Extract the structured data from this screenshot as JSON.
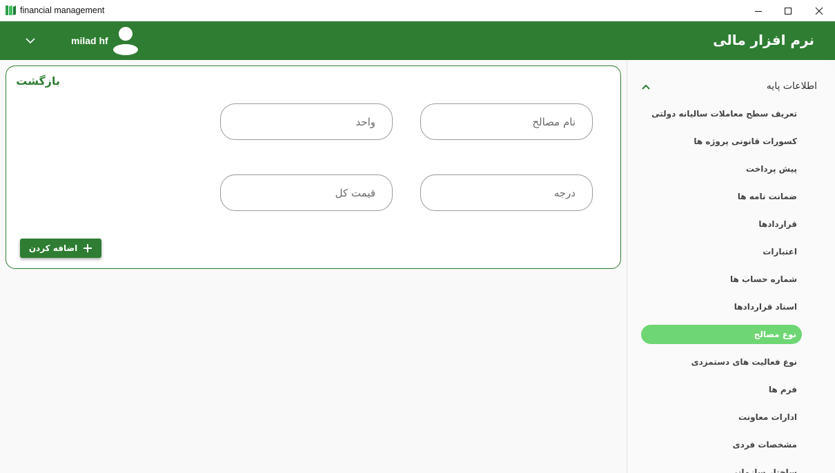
{
  "window": {
    "title": "financial management",
    "icon": "books-app-icon",
    "controls": [
      "minimize-icon",
      "maximize-icon",
      "close-icon"
    ]
  },
  "header": {
    "app_name": "نرم افزار مالی",
    "user_name": "milad hf",
    "avatar_icon": "user-avatar-icon",
    "menu_icon": "chevron-down-icon",
    "background_color": "#2e7d32"
  },
  "sidebar": {
    "section_title": "اطلاعات پایه",
    "section_icon": "chevron-up-icon",
    "items": [
      {
        "label": "تعریف سطح معاملات سالیانه دولتی",
        "active": false
      },
      {
        "label": "کسورات قانونی پروژه ها",
        "active": false
      },
      {
        "label": "پیش پرداخت",
        "active": false
      },
      {
        "label": "ضمانت نامه ها",
        "active": false
      },
      {
        "label": "قراردادها",
        "active": false
      },
      {
        "label": "اعتبارات",
        "active": false
      },
      {
        "label": "شماره حساب ها",
        "active": false
      },
      {
        "label": "اسناد قراردادها",
        "active": false
      },
      {
        "label": "نوع مصالح",
        "active": true
      },
      {
        "label": "نوع فعالیت های دستمزدی",
        "active": false
      },
      {
        "label": "فرم ها",
        "active": false
      },
      {
        "label": "ادارات معاونت",
        "active": false
      },
      {
        "label": "مشخصات فردی",
        "active": false
      },
      {
        "label": "ساختار سازمانی",
        "active": false
      }
    ],
    "active_color": "#6fd674"
  },
  "form": {
    "back_label": "بازگشت",
    "fields": {
      "material_name": {
        "placeholder": "نام مصالح",
        "value": ""
      },
      "unit": {
        "placeholder": "واحد",
        "value": ""
      },
      "grade": {
        "placeholder": "درجه",
        "value": ""
      },
      "total_price": {
        "placeholder": "قیمت کل",
        "value": ""
      }
    },
    "add_button": {
      "label": "اضافه کردن",
      "icon": "plus-icon"
    },
    "border_color": "#2e7d32"
  }
}
